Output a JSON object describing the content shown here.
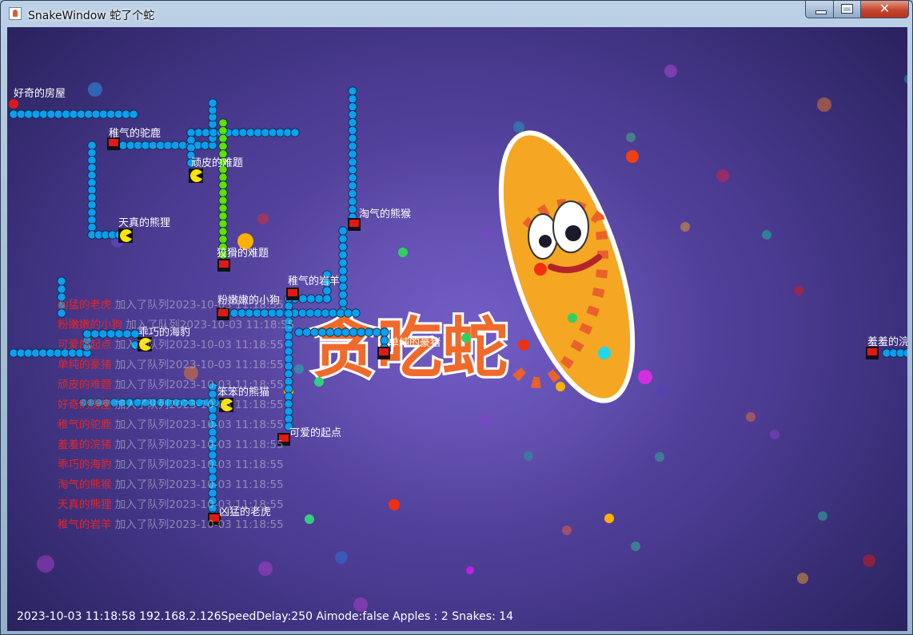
{
  "window": {
    "title": "SnakeWindow  蛇了个蛇",
    "minimize_label": "",
    "maximize_label": "",
    "close_label": "✕"
  },
  "logo": {
    "text": "贪吃蛇"
  },
  "snakes": [
    {
      "name": "好奇的房屋",
      "head": "red-dot"
    },
    {
      "name": "稚气的驼鹿",
      "head": "red-block"
    },
    {
      "name": "顽皮的难题",
      "head": "pacman"
    },
    {
      "name": "天真的熊狸",
      "head": "pacman"
    },
    {
      "name": "淘气的熊猴",
      "head": "red-block"
    },
    {
      "name": "狡猾的难题",
      "head": "red-block"
    },
    {
      "name": "稚气的岩羊",
      "head": "red-block"
    },
    {
      "name": "粉嫩嫩的小狗",
      "head": "red-block"
    },
    {
      "name": "乖巧的海豹",
      "head": "pacman"
    },
    {
      "name": "单纯的豪猪",
      "head": "red-block"
    },
    {
      "name": "笨笨的熊猫",
      "head": "pacman"
    },
    {
      "name": "可爱的起点",
      "head": "red-block"
    },
    {
      "name": "凶猛的老虎",
      "head": "red-block"
    },
    {
      "name": "羞羞的浣猪",
      "head": "red-block"
    }
  ],
  "join_log": [
    {
      "name": "凶猛的老虎",
      "message": "加入了队列2023-10-03 11:18:55"
    },
    {
      "name": "粉嫩嫩的小狗",
      "message": "加入了队列2023-10-03 11:18:55"
    },
    {
      "name": "可爱的起点",
      "message": "加入了队列2023-10-03 11:18:55"
    },
    {
      "name": "单纯的豪猪",
      "message": "加入了队列2023-10-03 11:18:55"
    },
    {
      "name": "顽皮的难题",
      "message": "加入了队列2023-10-03 11:18:55"
    },
    {
      "name": "好奇的房屋",
      "message": "加入了队列2023-10-03 11:18:55"
    },
    {
      "name": "稚气的驼鹿",
      "message": "加入了队列2023-10-03 11:18:55"
    },
    {
      "name": "羞羞的浣猪",
      "message": "加入了队列2023-10-03 11:18:55"
    },
    {
      "name": "乖巧的海豹",
      "message": "加入了队列2023-10-03 11:18:55"
    },
    {
      "name": "淘气的熊猴",
      "message": "加入了队列2023-10-03 11:18:55"
    },
    {
      "name": "天真的熊狸",
      "message": "加入了队列2023-10-03 11:18:55"
    },
    {
      "name": "稚气的岩羊",
      "message": "加入了队列2023-10-03 11:18:55"
    }
  ],
  "status": {
    "text": "2023-10-03 11:18:58  192.168.2.126SpeedDelay:250  Aimode:false Apples : 2 Snakes: 14",
    "apples": 2,
    "snakes": 14,
    "speed_delay": 250
  },
  "colors": {
    "snake_body": "#0a9ff0",
    "green_snake": "#5fe000",
    "head_red": "#e01818",
    "pacman": "#ffe600",
    "log_name": "#e4262a",
    "status_text": "#ffffff"
  }
}
